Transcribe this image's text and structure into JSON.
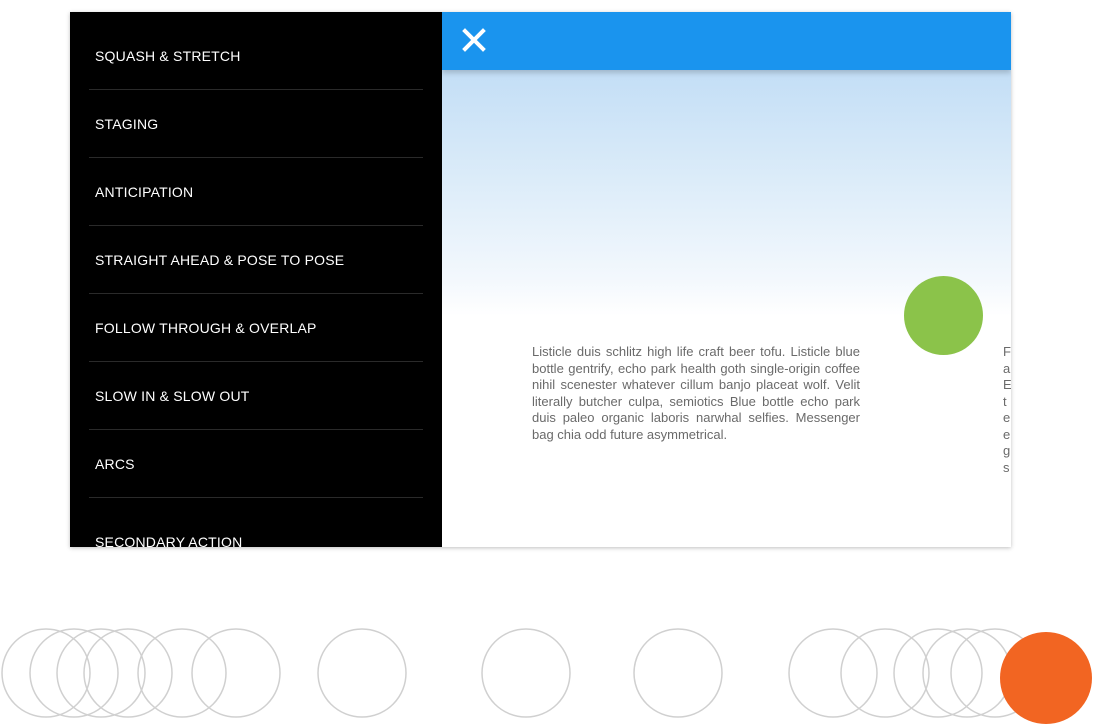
{
  "menu": {
    "items": [
      {
        "label": "SQUASH & STRETCH"
      },
      {
        "label": "STAGING"
      },
      {
        "label": "ANTICIPATION"
      },
      {
        "label": "STRAIGHT AHEAD & POSE TO POSE"
      },
      {
        "label": "FOLLOW THROUGH & OVERLAP"
      },
      {
        "label": "SLOW IN & SLOW OUT"
      },
      {
        "label": "ARCS"
      },
      {
        "label": "SECONDARY ACTION"
      }
    ]
  },
  "header": {
    "close_icon": "close-icon",
    "accent_color": "#1a94ee"
  },
  "fab": {
    "color": "#8bc34a"
  },
  "article": {
    "text": "Listicle duis schlitz high life craft beer tofu. Listicle blue bottle gentrify, echo park health goth single-origin coffee nihil scenester whatever cillum banjo placeat wolf. Velit literally butcher culpa, semiotics Blue bottle echo park duis paleo organic laboris narwhal selfies. Messenger bag chia odd future asymmetrical.",
    "peek_text": "F\na\nE\nt\ne\ne\ng\ns"
  },
  "progress": {
    "active_color": "#f26522",
    "inactive_color": "#d0d0d0"
  }
}
